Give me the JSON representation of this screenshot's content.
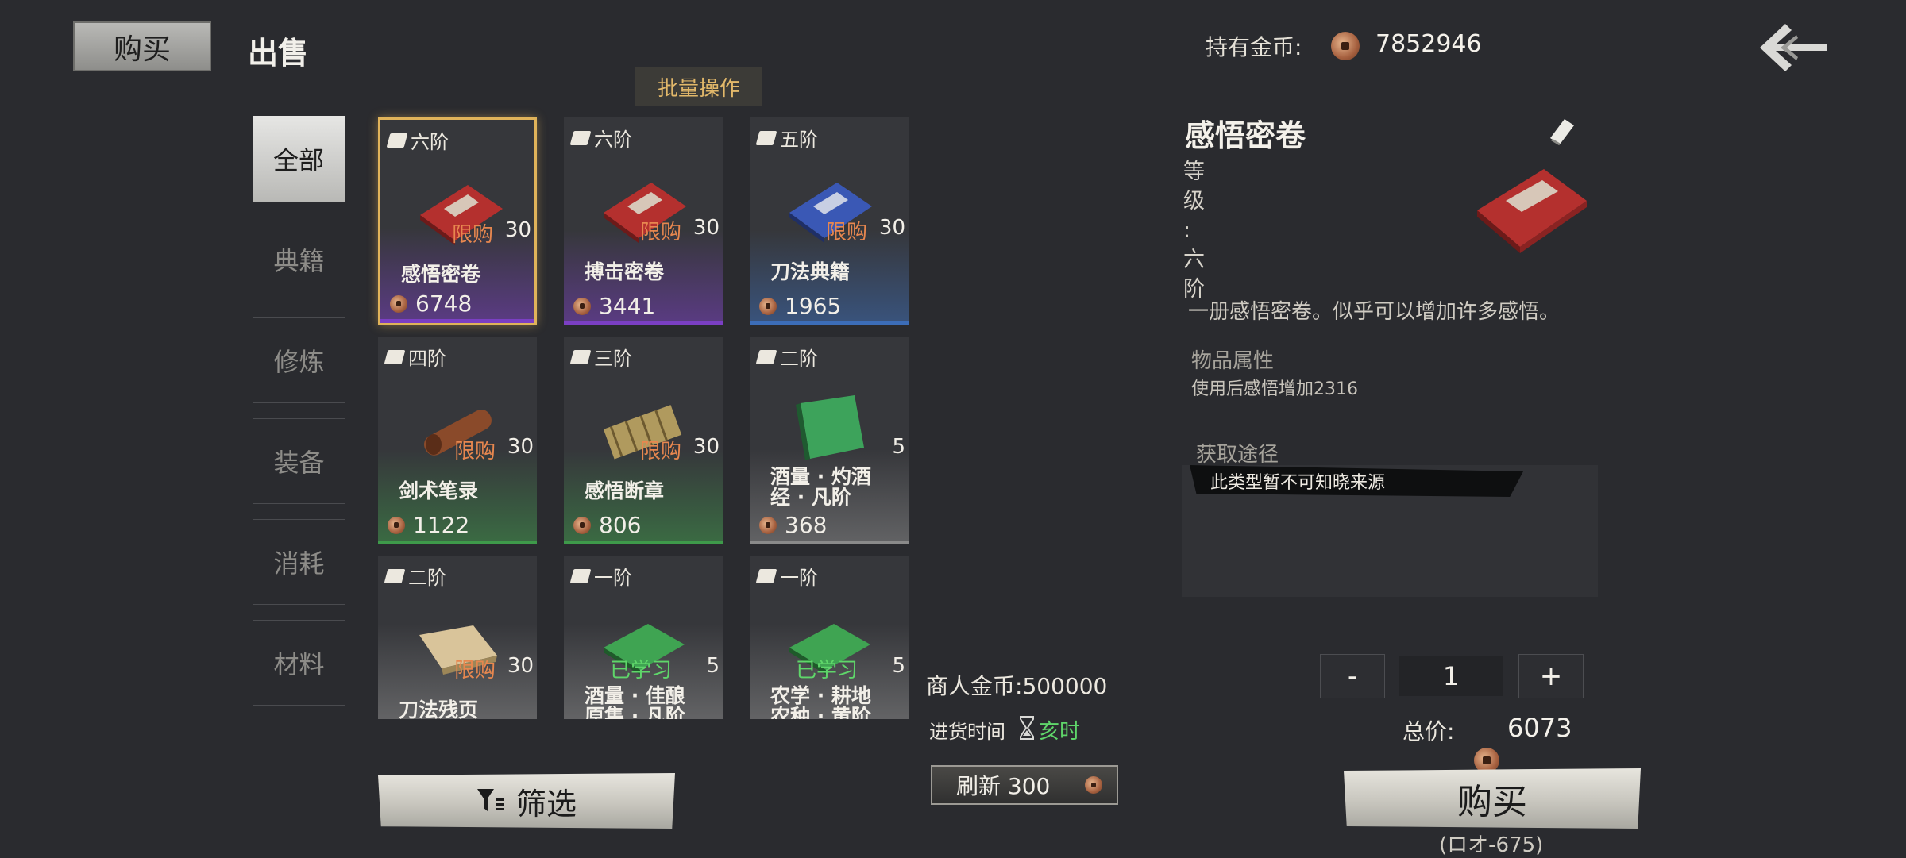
{
  "header": {
    "buy_tab": "购买",
    "sell_tab": "出售",
    "gold_label": "持有金币:",
    "gold_value": "7852946",
    "batch_label": "批量操作"
  },
  "categories": [
    "全部",
    "典籍",
    "修炼",
    "装备",
    "消耗",
    "材料"
  ],
  "active_category": "全部",
  "items": [
    {
      "tier": "六阶",
      "name": "感悟密卷",
      "name2": "",
      "price": "6748",
      "tag": "限购",
      "qty": "30",
      "rarity_color": "#7b3fc4",
      "art": "red-book",
      "selected": true
    },
    {
      "tier": "六阶",
      "name": "搏击密卷",
      "name2": "",
      "price": "3441",
      "tag": "限购",
      "qty": "30",
      "rarity_color": "#7b3fc4",
      "art": "red-book"
    },
    {
      "tier": "五阶",
      "name": "刀法典籍",
      "name2": "",
      "price": "1965",
      "tag": "限购",
      "qty": "30",
      "rarity_color": "#3c6db8",
      "art": "blue-book"
    },
    {
      "tier": "四阶",
      "name": "剑术笔录",
      "name2": "",
      "price": "1122",
      "tag": "限购",
      "qty": "30",
      "rarity_color": "#3e9a4a",
      "art": "scroll"
    },
    {
      "tier": "三阶",
      "name": "感悟断章",
      "name2": "",
      "price": "806",
      "tag": "限购",
      "qty": "30",
      "rarity_color": "#3e9a4a",
      "art": "bamboo"
    },
    {
      "tier": "二阶",
      "name": "酒量 · 灼酒",
      "name2": "经 · 凡阶",
      "price": "368",
      "tag": "",
      "qty": "5",
      "rarity_color": "#8a8a8a",
      "art": "green-book"
    },
    {
      "tier": "二阶",
      "name": "刀法残页",
      "name2": "",
      "price": "",
      "tag": "限购",
      "qty": "30",
      "rarity_color": "#8a8a8a",
      "art": "paper"
    },
    {
      "tier": "一阶",
      "name": "酒量 · 佳酿",
      "name2": "原集 · 凡阶",
      "price": "",
      "tag": "已学习",
      "qty": "5",
      "rarity_color": "#8a8a8a",
      "art": "green-book-flat"
    },
    {
      "tier": "一阶",
      "name": "农学 · 耕地",
      "name2": "农种 · 黄阶",
      "price": "",
      "tag": "已学习",
      "qty": "5",
      "rarity_color": "#8a8a8a",
      "art": "green-book-flat"
    }
  ],
  "merchant": {
    "gold_label": "商人金币:",
    "gold_value": "500000",
    "restock_label": "进货时间",
    "restock_time": "亥时",
    "refresh_label": "刷新 300",
    "filter_label": "筛选"
  },
  "detail": {
    "title": "感悟密卷",
    "level_chars": [
      "等",
      "级",
      ":",
      "六",
      "阶"
    ],
    "description": "一册感悟密卷。似乎可以增加许多感悟。",
    "attr_heading": "物品属性",
    "attr_line": "使用后感悟增加2316",
    "source_heading": "获取途径",
    "source_text": "此类型暂不可知晓来源",
    "quantity": "1",
    "minus_label": "-",
    "plus_label": "+",
    "total_label": "总价:",
    "total_value": "6073",
    "buy_label": "购买",
    "user_id": "(ロオ-675)"
  },
  "colors": {
    "background": "#2a2b2f",
    "selected_border": "#e0b35a",
    "limit_tag": "#e7874f",
    "learned_tag": "#5fd66a",
    "batch_text": "#e2b86a"
  }
}
